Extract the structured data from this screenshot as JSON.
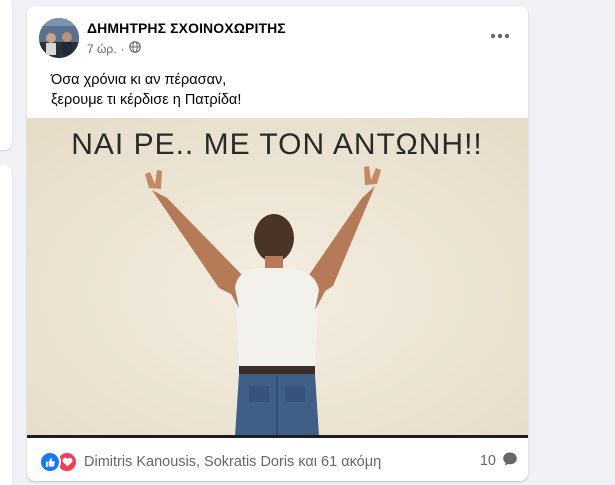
{
  "post": {
    "author": "ΔΗΜΗΤΡΗΣ ΣΧΟΙΝΟΧΩΡΙΤΗΣ",
    "time": "7 ώρ.",
    "separator": "·",
    "privacy_icon": "globe-icon",
    "more_icon": "more-options-icon",
    "text_lines": [
      "Όσα χρόνια κι αν πέρασαν,",
      "ξερουμε τι κέρδισε η Πατρίδα!"
    ],
    "image_caption": "ΝΑΙ ΡΕ.. ΜΕ ΤΟΝ ΑΝΤΩΝΗ!!"
  },
  "footer": {
    "reactions": [
      "like-reaction-icon",
      "love-reaction-icon"
    ],
    "reaction_names": "Dimitris Kanousis, Sokratis Doris και 61 ακόμη",
    "comment_count": "10",
    "comment_icon": "comment-bubble-icon"
  },
  "colors": {
    "background": "#f0f2f5",
    "card": "#ffffff",
    "meta_text": "#65676b",
    "like": "#1877f2",
    "love": "#f33e58"
  }
}
